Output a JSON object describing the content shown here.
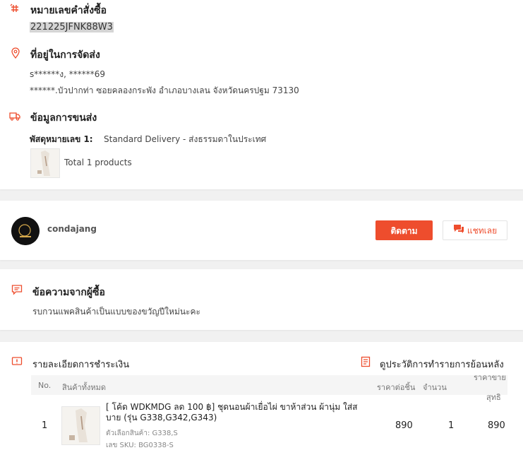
{
  "order_number": {
    "title": "หมายเลขคำสั่งซื้อ",
    "value": "221225JFNK88W3"
  },
  "shipping_address": {
    "title": "ที่อยู่ในการจัดส่ง",
    "name_phone": "s******ง, ******69",
    "address": "******.บัวปากท่า ซอยคลองกระพัง อำเภอบางเลน จังหวัดนครปฐม 73130"
  },
  "shipping_info": {
    "title": "ข้อมูลการขนส่ง",
    "parcel_label": "พัสดุหมายเลข 1:",
    "parcel_method": "Standard Delivery - ส่งธรรมดาในประเทศ",
    "total_products": "Total 1 products"
  },
  "shop": {
    "name": "condajang",
    "follow_label": "ติดตาม",
    "chat_label": "แชทเลย"
  },
  "buyer_message": {
    "title": "ข้อความจากผู้ซื้อ",
    "text": "รบกวนแพคสินค้าเป็นแบบของขวัญปีใหม่นะคะ"
  },
  "payment": {
    "title": "รายละเอียดการชำระเงิน",
    "history_link": "ดูประวัติการทำรายการย้อนหลัง",
    "columns": {
      "no": "No.",
      "products": "สินค้าทั้งหมด",
      "unit_price": "ราคาต่อชิ้น",
      "quantity": "จำนวน",
      "net_price_1": "ราคาขาย",
      "net_price_2": "สุทธิ"
    },
    "rows": [
      {
        "no": "1",
        "name_line1": "[ โค้ด WDKMDG ลด 100 ฿] ชุดนอนผ้าเยื่อไผ่ ขาห้าส่วน ผ้านุ่ม ใส่ส",
        "name_line2": "บาย (รุ่น G338,G342,G343)",
        "variation": "ตัวเลือกสินค้า: G338,S",
        "sku": "เลข SKU: BG0338-S",
        "unit_price": "890",
        "quantity": "1",
        "net_price": "890"
      }
    ]
  },
  "colors": {
    "accent": "#ee4d2d",
    "background": "#f1f1f1"
  }
}
